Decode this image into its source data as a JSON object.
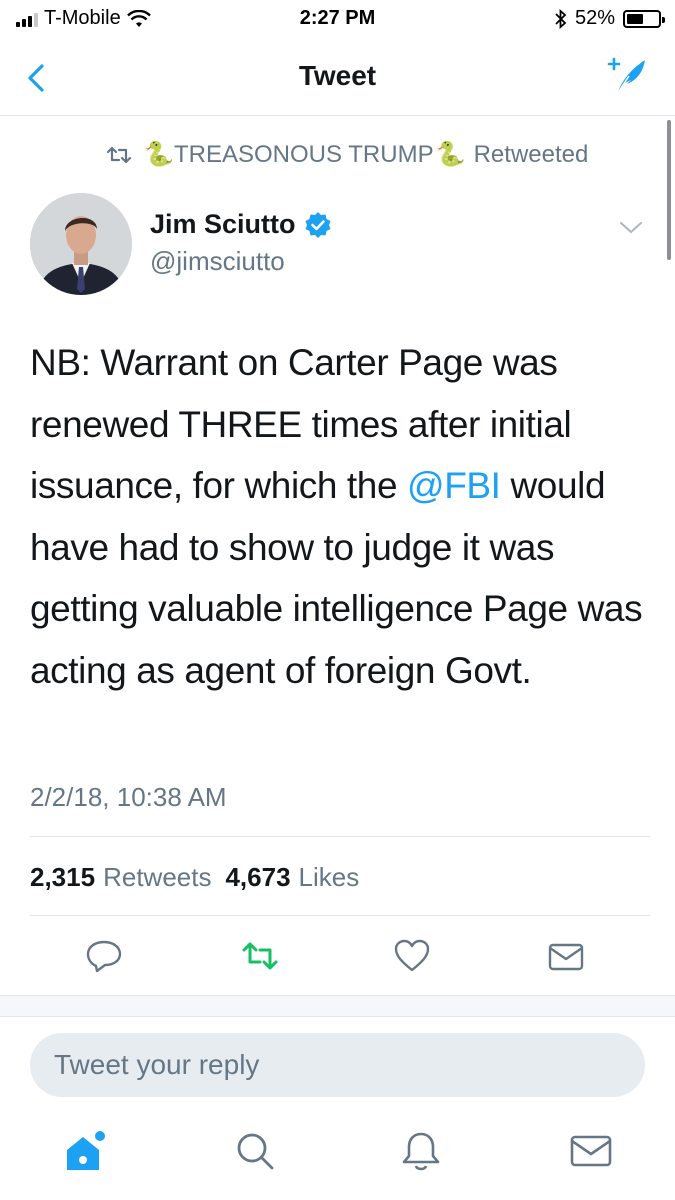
{
  "status_bar": {
    "carrier": "T-Mobile",
    "time": "2:27 PM",
    "battery": "52%",
    "battery_level": 0.52
  },
  "nav": {
    "title": "Tweet",
    "back_icon": "chevron-left-icon",
    "compose_icon": "compose-feather-icon"
  },
  "retweet_banner": {
    "retweeter": "TREASONOUS TRUMP",
    "emoji": "🐍",
    "suffix": "Retweeted"
  },
  "tweet": {
    "author_name": "Jim Sciutto",
    "author_handle": "@jimsciutto",
    "verified": true,
    "text_before_mention": "NB: Warrant on Carter Page was renewed THREE times after initial issuance, for which the ",
    "mention": "@FBI",
    "text_after_mention": " would have had to show to judge it was getting valuable intelligence Page was acting as agent of foreign Govt.",
    "timestamp": "2/2/18, 10:38 AM",
    "retweet_count": "2,315",
    "retweet_label": "Retweets",
    "like_count": "4,673",
    "like_label": "Likes"
  },
  "reply": {
    "placeholder": "Tweet your reply"
  },
  "colors": {
    "accent": "#1da1f2",
    "retweet_active": "#17bf63",
    "secondary_text": "#657786",
    "primary_text": "#14171a"
  }
}
